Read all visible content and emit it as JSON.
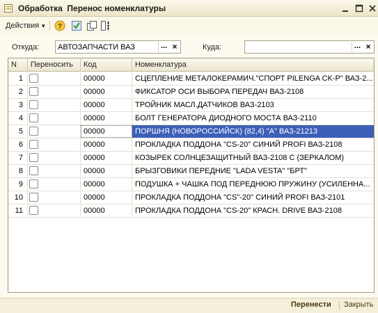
{
  "window": {
    "title": "Обработка  Перенос номенклатуры"
  },
  "toolbar": {
    "actions_label": "Действия",
    "icons": [
      "help-icon",
      "check-icon",
      "copy-icon",
      "columns-icon"
    ]
  },
  "fields": {
    "from_label": "Откуда:",
    "from_value": "АВТОЗАПЧАСТИ ВАЗ",
    "to_label": "Куда:",
    "to_value": "",
    "select_btn": "...",
    "clear_btn": "×"
  },
  "table": {
    "columns": [
      "N",
      "Переносить",
      "Код",
      "Номенклатура"
    ],
    "selected_row": 5,
    "rows": [
      {
        "n": "1",
        "code": "00000",
        "name": "СЦЕПЛЕНИЕ МЕТАЛОКЕРАМИЧ.\"СПОРТ PILENGA CK-P\" ВАЗ-2..."
      },
      {
        "n": "2",
        "code": "00000",
        "name": "ФИКСАТОР ОСИ ВЫБОРА ПЕРЕДАЧ ВАЗ-2108"
      },
      {
        "n": "3",
        "code": "00000",
        "name": "ТРОЙНИК МАСЛ.ДАТЧИКОВ ВАЗ-2103"
      },
      {
        "n": "4",
        "code": "00000",
        "name": "БОЛТ ГЕНЕРАТОРА ДИОДНОГО МОСТА ВАЗ-2110"
      },
      {
        "n": "5",
        "code": "00000",
        "name": "ПОРШНЯ (НОВОРОССИЙСК) (82,4) \"А\" ВАЗ-21213"
      },
      {
        "n": "6",
        "code": "00000",
        "name": "ПРОКЛАДКА ПОДДОНА \"CS-20\" СИНИЙ PROFI ВАЗ-2108"
      },
      {
        "n": "7",
        "code": "00000",
        "name": "КОЗЫРЕК СОЛНЦЕЗАЩИТНЫЙ ВАЗ-2108 С (ЗЕРКАЛОМ)"
      },
      {
        "n": "8",
        "code": "00000",
        "name": "БРЫЗГОВИКИ ПЕРЕДНИЕ \"LADA VESTA\" \"БРТ\""
      },
      {
        "n": "9",
        "code": "00000",
        "name": "ПОДУШКА + ЧАШКА ПОД ПЕРЕДНЮЮ ПРУЖИНУ (УСИЛЕННА..."
      },
      {
        "n": "10",
        "code": "00000",
        "name": "ПРОКЛАДКА ПОДДОНА \"CS\"-20\" СИНИЙ PROFI ВАЗ-2101"
      },
      {
        "n": "11",
        "code": "00000",
        "name": "ПРОКЛАДКА ПОДДОНА \"CS-20\" КРАСН. DRIVE ВАЗ-2108"
      }
    ]
  },
  "footer": {
    "move_label": "Перенести",
    "close_label": "Закрыть"
  },
  "colors": {
    "selection": "#3c5fb8",
    "background": "#fdfbf0"
  }
}
